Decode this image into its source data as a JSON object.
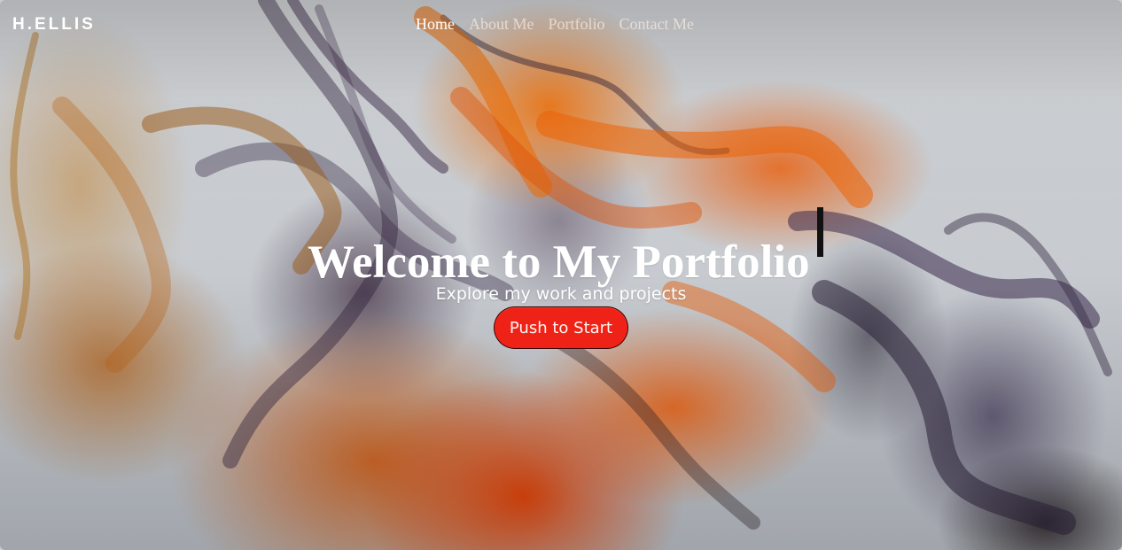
{
  "brand": {
    "logo_text": "H.ELLIS"
  },
  "nav": {
    "items": [
      {
        "label": "Home",
        "active": true
      },
      {
        "label": "About Me",
        "active": false
      },
      {
        "label": "Portfolio",
        "active": false
      },
      {
        "label": "Contact Me",
        "active": false
      }
    ]
  },
  "hero": {
    "title": "Welcome to My Portfolio",
    "subtitle": "Explore my work and projects",
    "cta_label": "Push to Start"
  },
  "colors": {
    "accent": "#ef2217",
    "text": "#ffffff"
  }
}
